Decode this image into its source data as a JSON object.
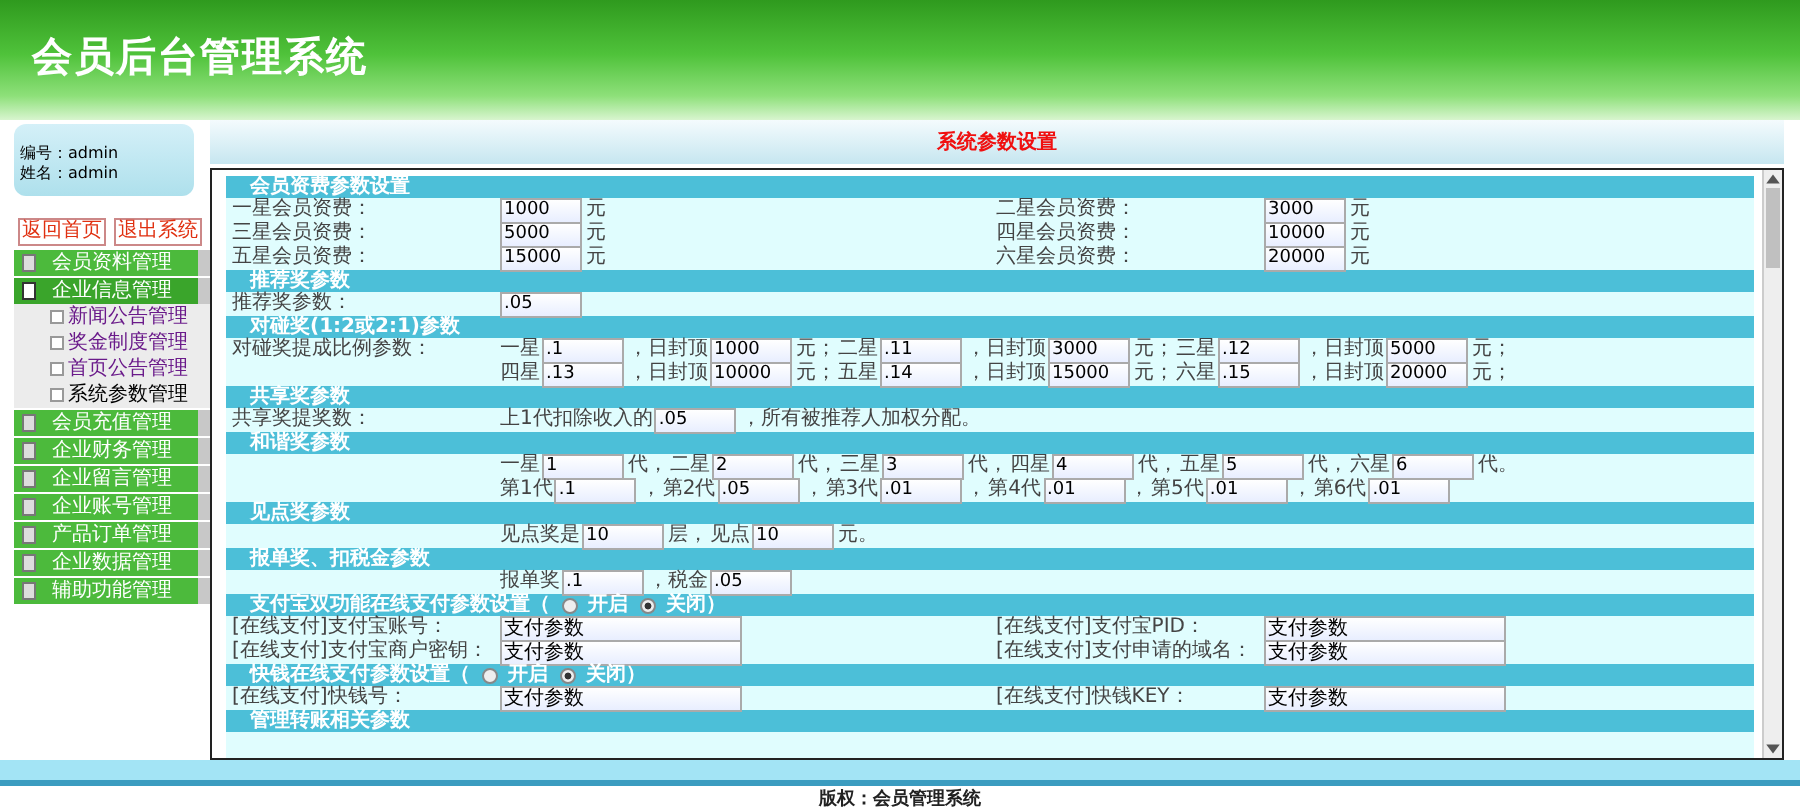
{
  "header": {
    "title": "会员后台管理系统"
  },
  "sidebar": {
    "user_lines": [
      "编号：admin",
      "姓名：admin"
    ],
    "buttons": [
      "返回首页",
      "退出系统"
    ],
    "menu": [
      {
        "label": "会员资料管理",
        "expanded": false
      },
      {
        "label": "企业信息管理",
        "expanded": true,
        "children": [
          {
            "label": "新闻公告管理",
            "selected": false
          },
          {
            "label": "奖金制度管理",
            "selected": false
          },
          {
            "label": "首页公告管理",
            "selected": false
          },
          {
            "label": "系统参数管理",
            "selected": true
          }
        ]
      },
      {
        "label": "会员充值管理",
        "expanded": false
      },
      {
        "label": "企业财务管理",
        "expanded": false
      },
      {
        "label": "企业留言管理",
        "expanded": false
      },
      {
        "label": "企业账号管理",
        "expanded": false
      },
      {
        "label": "产品订单管理",
        "expanded": false
      },
      {
        "label": "企业数据管理",
        "expanded": false
      },
      {
        "label": "辅助功能管理",
        "expanded": false
      }
    ]
  },
  "page_title": "系统参数设置",
  "sections": [
    {
      "title": "会员资费参数设置",
      "rows": [
        {
          "cells": [
            {
              "label": "一星会员资费：",
              "lines": [
                [
                  {
                    "kind": "field",
                    "value": "1000"
                  },
                  {
                    "kind": "text",
                    "text": "元"
                  }
                ]
              ]
            },
            {
              "label": "二星会员资费：",
              "lines": [
                [
                  {
                    "kind": "field",
                    "value": "3000"
                  },
                  {
                    "kind": "text",
                    "text": "元"
                  }
                ]
              ]
            }
          ]
        },
        {
          "cells": [
            {
              "label": "三星会员资费：",
              "lines": [
                [
                  {
                    "kind": "field",
                    "value": "5000"
                  },
                  {
                    "kind": "text",
                    "text": "元"
                  }
                ]
              ]
            },
            {
              "label": "四星会员资费：",
              "lines": [
                [
                  {
                    "kind": "field",
                    "value": "10000"
                  },
                  {
                    "kind": "text",
                    "text": "元"
                  }
                ]
              ]
            }
          ]
        },
        {
          "cells": [
            {
              "label": "五星会员资费：",
              "lines": [
                [
                  {
                    "kind": "field",
                    "value": "15000"
                  },
                  {
                    "kind": "text",
                    "text": "元"
                  }
                ]
              ]
            },
            {
              "label": "六星会员资费：",
              "lines": [
                [
                  {
                    "kind": "field",
                    "value": "20000"
                  },
                  {
                    "kind": "text",
                    "text": "元"
                  }
                ]
              ]
            }
          ]
        }
      ]
    },
    {
      "title": "推荐奖参数",
      "rows": [
        {
          "cells": [
            {
              "label": "推荐奖参数：",
              "lines": [
                [
                  {
                    "kind": "field",
                    "value": ".05"
                  }
                ]
              ]
            }
          ]
        }
      ]
    },
    {
      "title": "对碰奖(1:2或2:1)参数",
      "rows": [
        {
          "cells": [
            {
              "label": "对碰奖提成比例参数：",
              "lines": [
                [
                  {
                    "kind": "text",
                    "text": "一星"
                  },
                  {
                    "kind": "field",
                    "value": ".1"
                  },
                  {
                    "kind": "text",
                    "text": "，日封顶"
                  },
                  {
                    "kind": "field",
                    "value": "1000"
                  },
                  {
                    "kind": "text",
                    "text": "元；"
                  },
                  {
                    "kind": "text",
                    "text": "二星"
                  },
                  {
                    "kind": "field",
                    "value": ".11"
                  },
                  {
                    "kind": "text",
                    "text": "，日封顶"
                  },
                  {
                    "kind": "field",
                    "value": "3000"
                  },
                  {
                    "kind": "text",
                    "text": "元；"
                  },
                  {
                    "kind": "text",
                    "text": "三星"
                  },
                  {
                    "kind": "field",
                    "value": ".12"
                  },
                  {
                    "kind": "text",
                    "text": "，日封顶"
                  },
                  {
                    "kind": "field",
                    "value": "5000"
                  },
                  {
                    "kind": "text",
                    "text": "元；"
                  }
                ],
                [
                  {
                    "kind": "text",
                    "text": "四星"
                  },
                  {
                    "kind": "field",
                    "value": ".13"
                  },
                  {
                    "kind": "text",
                    "text": "，日封顶"
                  },
                  {
                    "kind": "field",
                    "value": "10000"
                  },
                  {
                    "kind": "text",
                    "text": "元；"
                  },
                  {
                    "kind": "text",
                    "text": "五星"
                  },
                  {
                    "kind": "field",
                    "value": ".14"
                  },
                  {
                    "kind": "text",
                    "text": "，日封顶"
                  },
                  {
                    "kind": "field",
                    "value": "15000"
                  },
                  {
                    "kind": "text",
                    "text": "元；"
                  },
                  {
                    "kind": "text",
                    "text": "六星"
                  },
                  {
                    "kind": "field",
                    "value": ".15"
                  },
                  {
                    "kind": "text",
                    "text": "，日封顶"
                  },
                  {
                    "kind": "field",
                    "value": "20000"
                  },
                  {
                    "kind": "text",
                    "text": "元；"
                  }
                ]
              ]
            }
          ]
        }
      ]
    },
    {
      "title": "共享奖参数",
      "rows": [
        {
          "cells": [
            {
              "label": "共享奖提奖数：",
              "lines": [
                [
                  {
                    "kind": "text",
                    "text": "上1代扣除收入的"
                  },
                  {
                    "kind": "field",
                    "value": ".05"
                  },
                  {
                    "kind": "text",
                    "text": "，所有被推荐人加权分配。"
                  }
                ]
              ]
            }
          ]
        }
      ]
    },
    {
      "title": "和谐奖参数",
      "rows": [
        {
          "cells": [
            {
              "lines": [
                [
                  {
                    "kind": "text",
                    "text": "一星"
                  },
                  {
                    "kind": "field",
                    "value": "1"
                  },
                  {
                    "kind": "text",
                    "text": "代，"
                  },
                  {
                    "kind": "text",
                    "text": "二星"
                  },
                  {
                    "kind": "field",
                    "value": "2"
                  },
                  {
                    "kind": "text",
                    "text": "代，"
                  },
                  {
                    "kind": "text",
                    "text": "三星"
                  },
                  {
                    "kind": "field",
                    "value": "3"
                  },
                  {
                    "kind": "text",
                    "text": "代，"
                  },
                  {
                    "kind": "text",
                    "text": "四星"
                  },
                  {
                    "kind": "field",
                    "value": "4"
                  },
                  {
                    "kind": "text",
                    "text": "代，"
                  },
                  {
                    "kind": "text",
                    "text": "五星"
                  },
                  {
                    "kind": "field",
                    "value": "5"
                  },
                  {
                    "kind": "text",
                    "text": "代，"
                  },
                  {
                    "kind": "text",
                    "text": "六星"
                  },
                  {
                    "kind": "field",
                    "value": "6"
                  },
                  {
                    "kind": "text",
                    "text": "代。"
                  }
                ],
                [
                  {
                    "kind": "text",
                    "text": "第1代"
                  },
                  {
                    "kind": "field",
                    "value": ".1"
                  },
                  {
                    "kind": "text",
                    "text": "，"
                  },
                  {
                    "kind": "text",
                    "text": "第2代"
                  },
                  {
                    "kind": "field",
                    "value": ".05"
                  },
                  {
                    "kind": "text",
                    "text": "，"
                  },
                  {
                    "kind": "text",
                    "text": "第3代"
                  },
                  {
                    "kind": "field",
                    "value": ".01"
                  },
                  {
                    "kind": "text",
                    "text": "，"
                  },
                  {
                    "kind": "text",
                    "text": "第4代"
                  },
                  {
                    "kind": "field",
                    "value": ".01"
                  },
                  {
                    "kind": "text",
                    "text": "，"
                  },
                  {
                    "kind": "text",
                    "text": "第5代"
                  },
                  {
                    "kind": "field",
                    "value": ".01"
                  },
                  {
                    "kind": "text",
                    "text": "，"
                  },
                  {
                    "kind": "text",
                    "text": "第6代"
                  },
                  {
                    "kind": "field",
                    "value": ".01"
                  }
                ]
              ]
            }
          ]
        }
      ]
    },
    {
      "title": "见点奖参数",
      "rows": [
        {
          "cells": [
            {
              "lines": [
                [
                  {
                    "kind": "text",
                    "text": "见点奖是"
                  },
                  {
                    "kind": "field",
                    "value": "10"
                  },
                  {
                    "kind": "text",
                    "text": "层，"
                  },
                  {
                    "kind": "text",
                    "text": "见点"
                  },
                  {
                    "kind": "field",
                    "value": "10"
                  },
                  {
                    "kind": "text",
                    "text": "元。"
                  }
                ]
              ]
            }
          ]
        }
      ]
    },
    {
      "title": "报单奖、扣税金参数",
      "rows": [
        {
          "cells": [
            {
              "lines": [
                [
                  {
                    "kind": "text",
                    "text": "报单奖"
                  },
                  {
                    "kind": "field",
                    "value": ".1"
                  },
                  {
                    "kind": "text",
                    "text": "，税金"
                  },
                  {
                    "kind": "field",
                    "value": ".05"
                  }
                ]
              ]
            }
          ]
        }
      ]
    },
    {
      "title": "支付宝双功能在线支付参数设置（",
      "options": [
        {
          "label": "开启",
          "selected": false
        },
        {
          "label": "关闭",
          "selected": true
        }
      ],
      "title_end": "）",
      "rows": [
        {
          "cells": [
            {
              "label": "[在线支付]支付宝账号：",
              "lines": [
                [
                  {
                    "kind": "long-field",
                    "value": "支付参数"
                  }
                ]
              ]
            },
            {
              "label": "[在线支付]支付宝PID：",
              "lines": [
                [
                  {
                    "kind": "long-field",
                    "value": "支付参数"
                  }
                ]
              ]
            }
          ]
        },
        {
          "cells": [
            {
              "label": "[在线支付]支付宝商户密钥：",
              "lines": [
                [
                  {
                    "kind": "long-field",
                    "value": "支付参数"
                  }
                ]
              ]
            },
            {
              "label": "[在线支付]支付申请的域名：",
              "lines": [
                [
                  {
                    "kind": "long-field",
                    "value": "支付参数"
                  }
                ]
              ]
            }
          ]
        }
      ]
    },
    {
      "title": "快钱在线支付参数设置（",
      "options": [
        {
          "label": "开启",
          "selected": false
        },
        {
          "label": "关闭",
          "selected": true
        }
      ],
      "title_end": "）",
      "rows": [
        {
          "cells": [
            {
              "label": "[在线支付]快钱号：",
              "lines": [
                [
                  {
                    "kind": "long-field",
                    "value": "支付参数"
                  }
                ]
              ]
            },
            {
              "label": "[在线支付]快钱KEY：",
              "lines": [
                [
                  {
                    "kind": "long-field",
                    "value": "支付参数"
                  }
                ]
              ]
            }
          ]
        }
      ]
    },
    {
      "title": "管理转账相关参数"
    }
  ],
  "footer": "版权：会员管理系统"
}
